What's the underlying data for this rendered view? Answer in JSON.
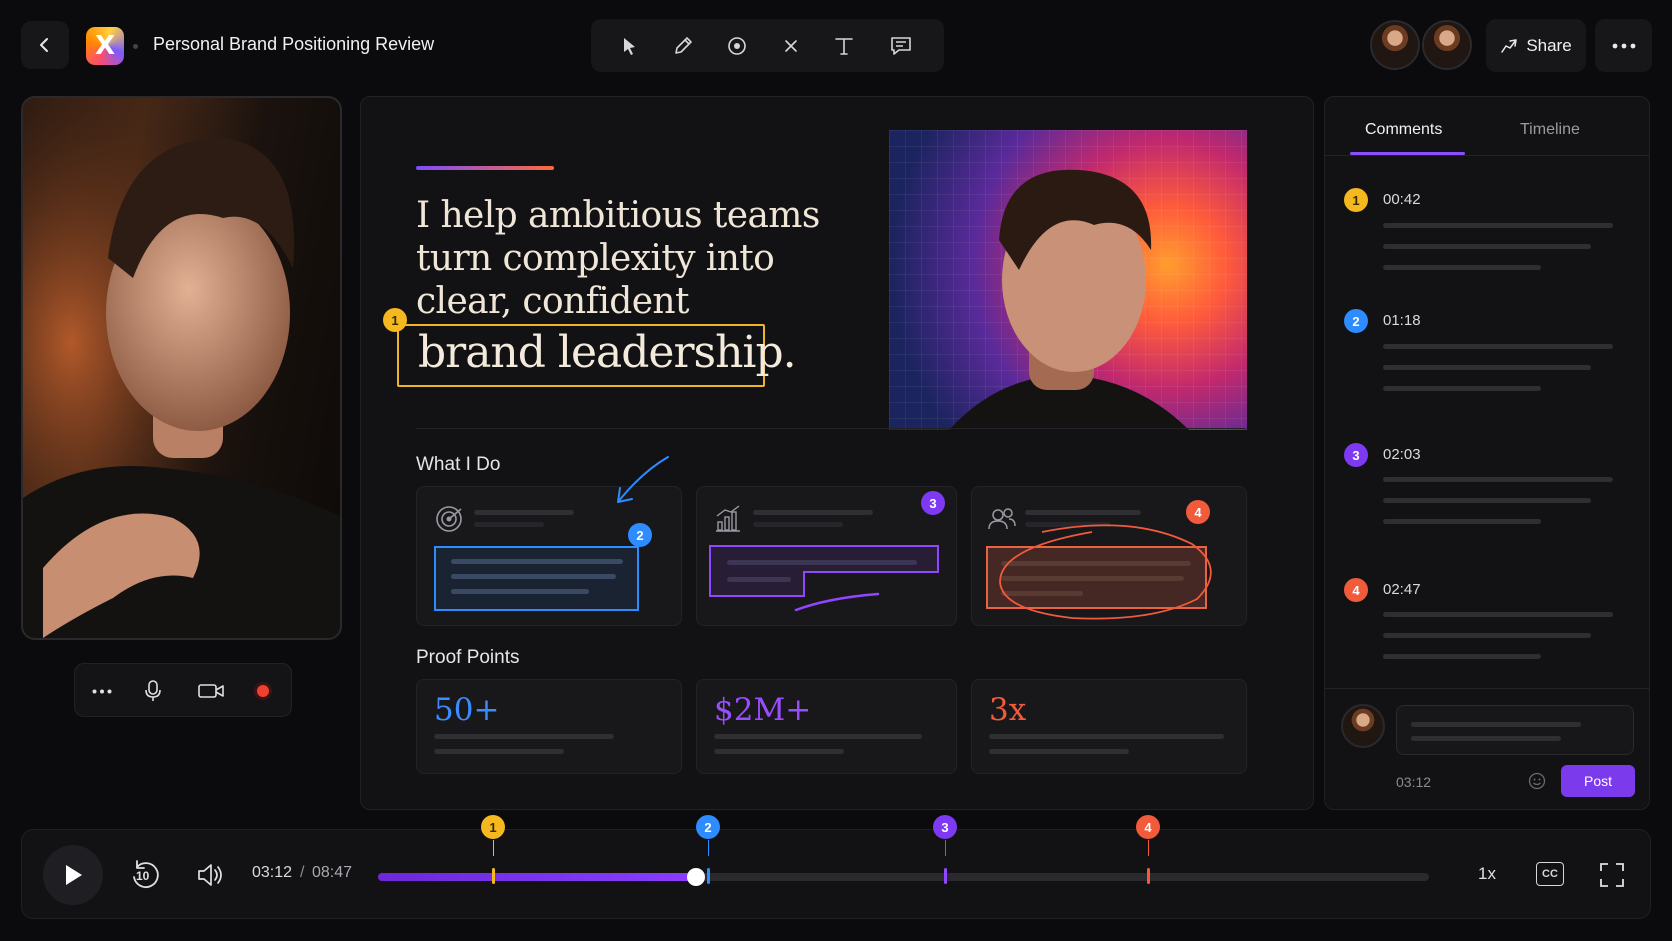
{
  "header": {
    "title": "Personal Brand Positioning Review",
    "app_logo_letter": "X",
    "share_label": "Share",
    "tools": [
      "select-tool",
      "pen-tool",
      "circle-tool",
      "eraser-tool",
      "text-tool",
      "comment-tool"
    ]
  },
  "slide": {
    "headline_lines": [
      "I help ambitious teams",
      "turn complexity into",
      "clear, confident"
    ],
    "headline_emphasis": "brand leadership.",
    "what_i_do_label": "What I Do",
    "proof_points_label": "Proof Points",
    "proof_values": [
      "50+",
      "$2M+",
      "3x"
    ],
    "pins": [
      "1",
      "2",
      "3",
      "4"
    ]
  },
  "panel": {
    "tabs": [
      "Comments",
      "Timeline"
    ],
    "active_tab": "Comments",
    "comments": [
      {
        "num": "1",
        "time": "00:42",
        "color": "#f5b81f"
      },
      {
        "num": "2",
        "time": "01:18",
        "color": "#2d8cff"
      },
      {
        "num": "3",
        "time": "02:03",
        "color": "#7e3af2"
      },
      {
        "num": "4",
        "time": "02:47",
        "color": "#f25a3c"
      }
    ],
    "input_timestamp": "03:12",
    "post_label": "Post"
  },
  "player": {
    "current_time": "03:12",
    "separator": "/",
    "duration": "08:47",
    "skip_back_label": "10",
    "speed": "1x",
    "cc_label": "CC",
    "progress_fraction": 0.303,
    "markers": [
      "1",
      "2",
      "3",
      "4"
    ]
  },
  "colors": {
    "accent": "#7c3aed",
    "marker_yellow": "#f5b81f",
    "marker_blue": "#2d8cff",
    "marker_purple": "#7e3af2",
    "marker_red": "#f25a3c"
  }
}
